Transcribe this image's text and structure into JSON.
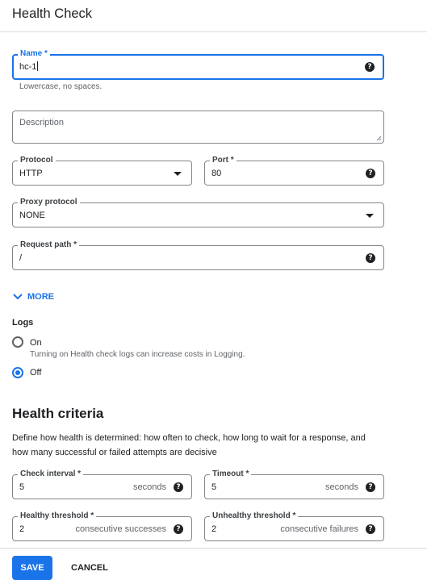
{
  "header": {
    "title": "Health Check"
  },
  "form": {
    "name": {
      "label": "Name *",
      "value": "hc-1",
      "hint": "Lowercase, no spaces."
    },
    "description": {
      "placeholder": "Description"
    },
    "protocol": {
      "label": "Protocol",
      "value": "HTTP"
    },
    "port": {
      "label": "Port *",
      "value": "80"
    },
    "proxy_protocol": {
      "label": "Proxy protocol",
      "value": "NONE"
    },
    "request_path": {
      "label": "Request path *",
      "value": "/"
    },
    "more_label": "MORE"
  },
  "logs": {
    "label": "Logs",
    "options": [
      {
        "label": "On",
        "checked": false,
        "note": "Turning on Health check logs can increase costs in Logging."
      },
      {
        "label": "Off",
        "checked": true
      }
    ]
  },
  "criteria": {
    "title": "Health criteria",
    "description": "Define how health is determined: how often to check, how long to wait for a response, and how many successful or failed attempts are decisive",
    "check_interval": {
      "label": "Check interval *",
      "value": "5",
      "unit": "seconds"
    },
    "timeout": {
      "label": "Timeout *",
      "value": "5",
      "unit": "seconds"
    },
    "healthy_threshold": {
      "label": "Healthy threshold *",
      "value": "2",
      "unit": "consecutive successes"
    },
    "unhealthy_threshold": {
      "label": "Unhealthy threshold *",
      "value": "2",
      "unit": "consecutive failures"
    }
  },
  "footer": {
    "save_label": "SAVE",
    "cancel_label": "CANCEL"
  },
  "colors": {
    "accent": "#1a73e8",
    "border": "#80868b",
    "text": "#202124",
    "muted": "#5f6368"
  },
  "icons": {
    "help": "help-circle-icon",
    "dropdown": "arrow-drop-down-icon",
    "expand": "chevron-down-icon"
  }
}
